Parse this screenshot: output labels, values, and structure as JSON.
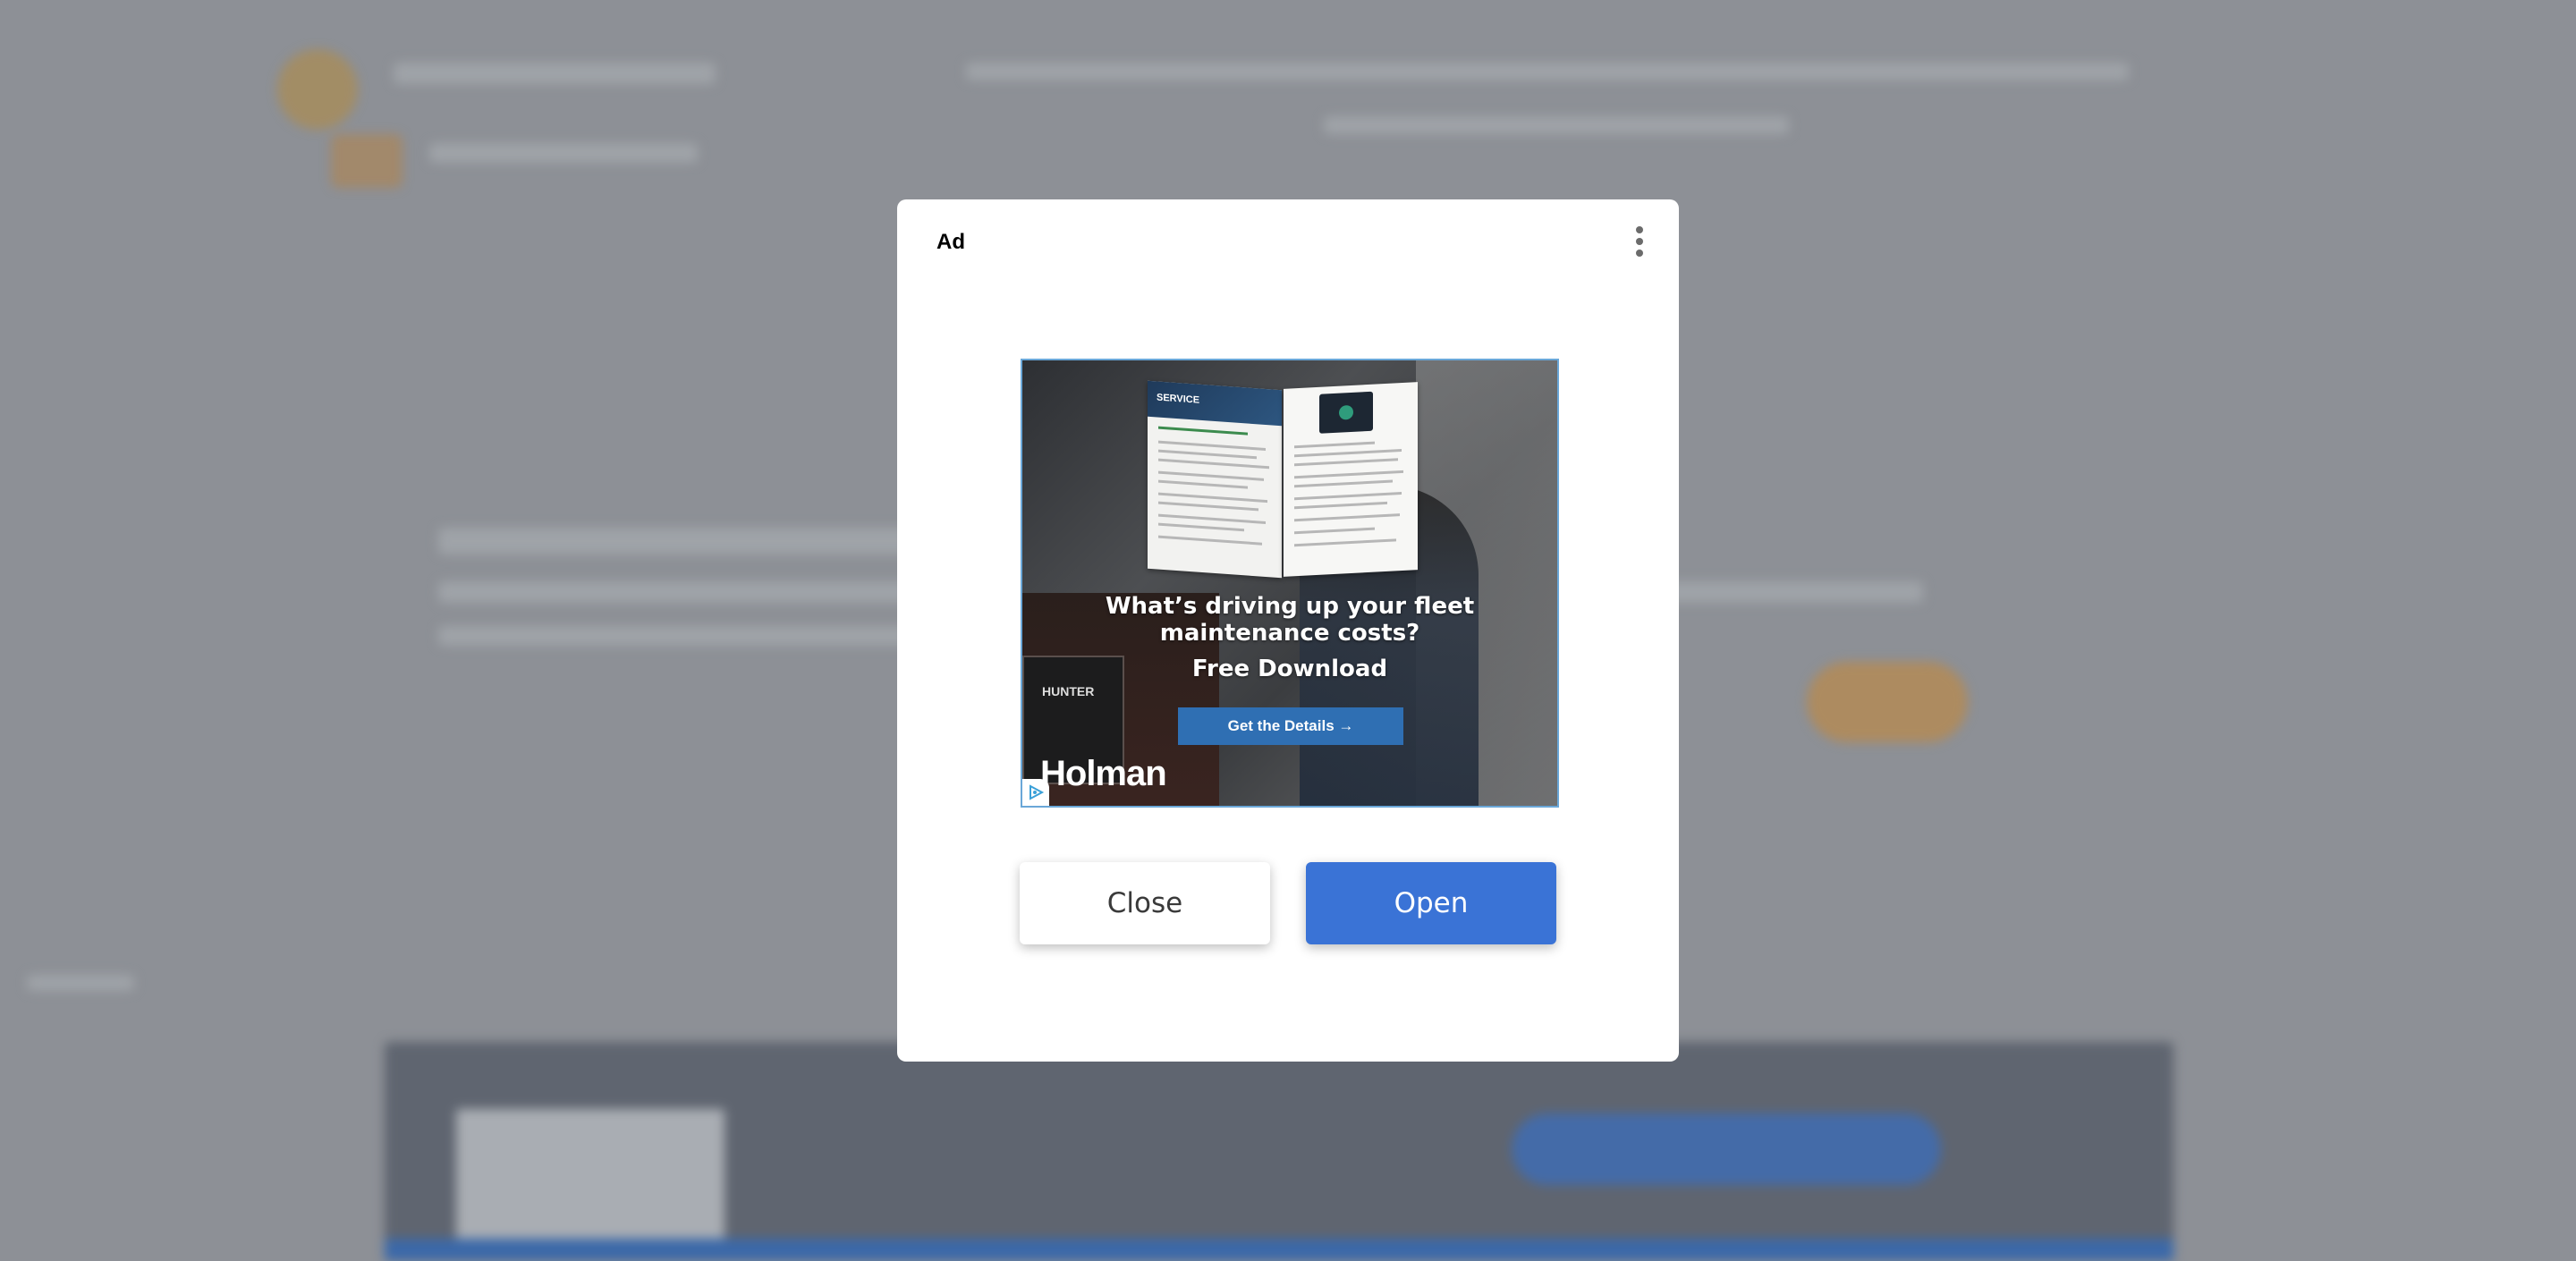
{
  "modal": {
    "ad_label": "Ad",
    "close_label": "Close",
    "open_label": "Open"
  },
  "ad": {
    "headline": "What’s driving up your fleet maintenance costs?",
    "subheadline": "Free Download",
    "cta": "Get the Details →",
    "brand": "Holman",
    "brochure_header": "SERVICE",
    "machine_label": "HUNTER"
  },
  "colors": {
    "overlay": "#8d9096",
    "open_button": "#3a73d6",
    "cta_button": "#2f6fb3",
    "ad_border": "#6aa7d8"
  },
  "icons": [
    "more-vert-icon",
    "adchoices-icon"
  ]
}
